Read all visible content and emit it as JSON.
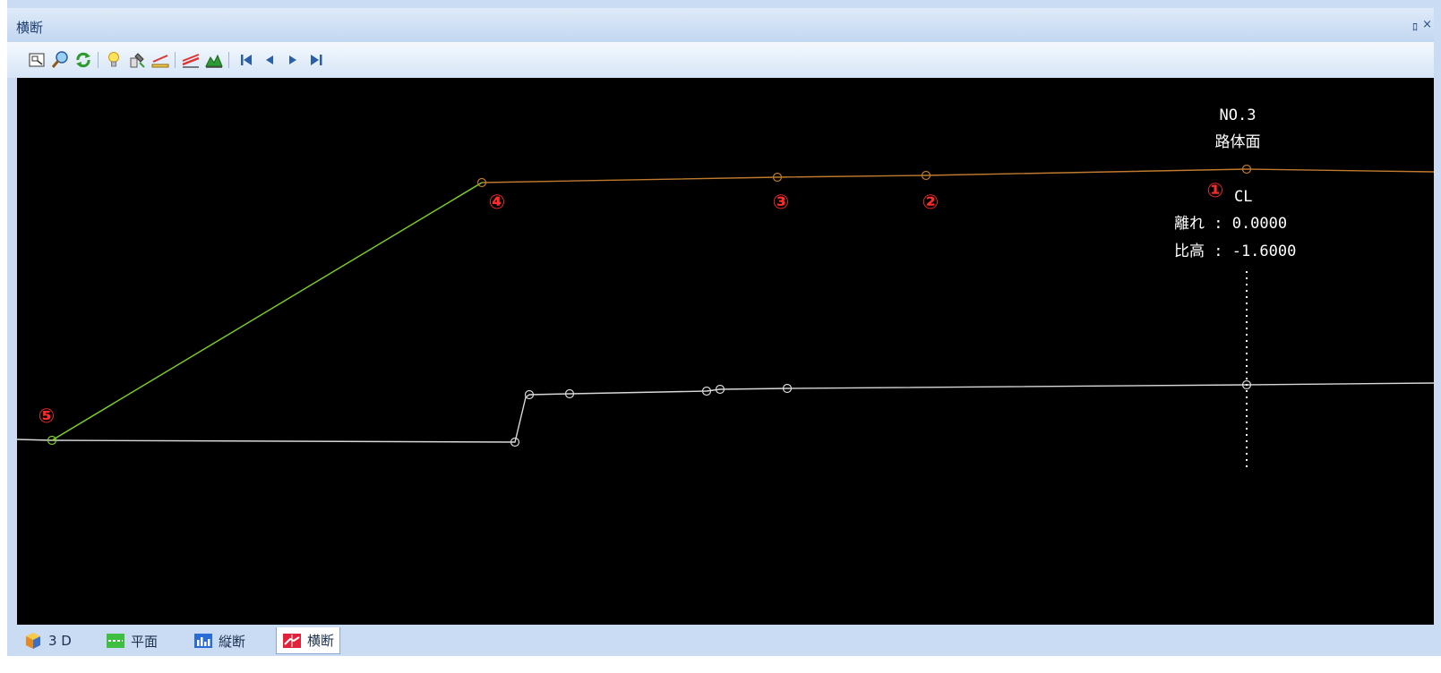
{
  "window": {
    "title": "横断",
    "pin_glyph": "ﾛ",
    "close_glyph": "×"
  },
  "toolbar": {
    "buttons": [
      {
        "name": "fit-view-icon"
      },
      {
        "name": "zoom-icon"
      },
      {
        "name": "refresh-icon"
      },
      {
        "name": "light-icon"
      },
      {
        "name": "settings-icon"
      },
      {
        "name": "measure-icon"
      },
      {
        "name": "layers-icon"
      },
      {
        "name": "terrain-icon"
      },
      {
        "name": "first-icon"
      },
      {
        "name": "prev-icon"
      },
      {
        "name": "next-icon"
      },
      {
        "name": "last-icon"
      }
    ]
  },
  "cross_section": {
    "station": "NO.3",
    "surface": "路体面",
    "centerline_label": "CL",
    "offset_text": "離れ : 0.0000",
    "height_text": "比高 : -1.6000",
    "points": [
      "①",
      "②",
      "③",
      "④",
      "⑤"
    ],
    "colors": {
      "road": "#c07a2e",
      "slope": "#7fd321",
      "ground": "#d8d8d8",
      "marker": "#ff2a2a"
    }
  },
  "tabs": [
    {
      "label": "3 D",
      "icon": "cube-icon"
    },
    {
      "label": "平面",
      "icon": "plan-icon"
    },
    {
      "label": "縦断",
      "icon": "profile-icon"
    },
    {
      "label": "横断",
      "icon": "cross-section-icon",
      "active": true
    }
  ]
}
